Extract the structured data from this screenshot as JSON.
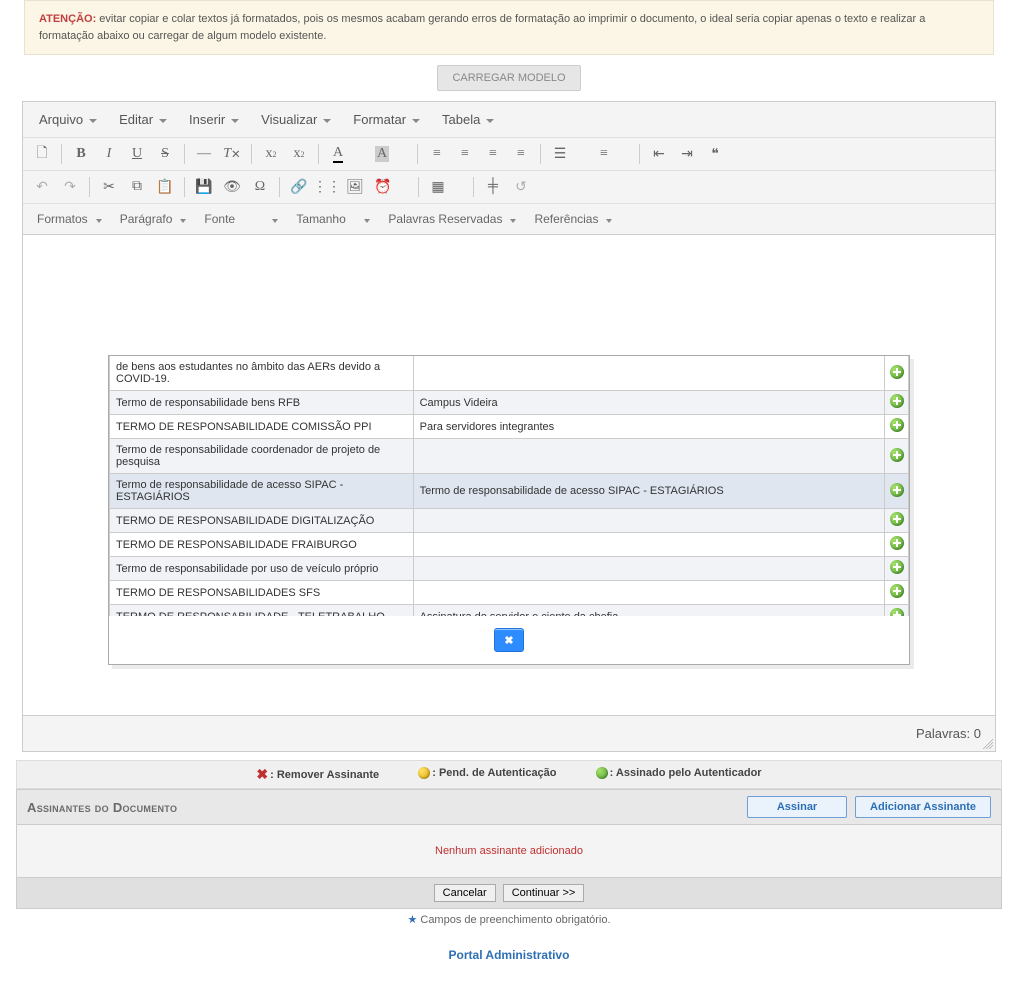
{
  "warning": {
    "prefix": "ATENÇÃO:",
    "text": "evitar copiar e colar textos já formatados, pois os mesmos acabam gerando erros de formatação ao imprimir o documento, o ideal seria copiar apenas o texto e realizar a formatação abaixo ou carregar de algum modelo existente."
  },
  "buttons": {
    "carregar_modelo": "CARREGAR MODELO",
    "assinar": "Assinar",
    "adicionar_assinante": "Adicionar Assinante",
    "cancelar": "Cancelar",
    "continuar": "Continuar >>",
    "close_x": "✖"
  },
  "editor_menu": {
    "arquivo": "Arquivo",
    "editar": "Editar",
    "inserir": "Inserir",
    "visualizar": "Visualizar",
    "formatar": "Formatar",
    "tabela": "Tabela"
  },
  "editor_dropdowns": {
    "formatos": "Formatos",
    "paragrafo": "Parágrafo",
    "fonte": "Fonte",
    "tamanho": "Tamanho",
    "palavras_reservadas": "Palavras Reservadas",
    "referencias": "Referências"
  },
  "editor_footer": {
    "palavras_label": "Palavras:",
    "palavras_count": "0"
  },
  "modal_rows": [
    {
      "col1": "de bens aos estudantes no âmbito das AERs devido a COVID-19.",
      "col2": "",
      "truncated_top": true
    },
    {
      "col1": "Termo de responsabilidade bens RFB",
      "col2": "Campus Videira"
    },
    {
      "col1": "TERMO DE RESPONSABILIDADE COMISSÃO PPI",
      "col2": "Para servidores integrantes"
    },
    {
      "col1": "Termo de responsabilidade coordenador de projeto de pesquisa",
      "col2": ""
    },
    {
      "col1": "Termo de responsabilidade de acesso SIPAC - ESTAGIÁRIOS",
      "col2": "Termo de responsabilidade de acesso SIPAC - ESTAGIÁRIOS",
      "selected": true
    },
    {
      "col1": "TERMO DE RESPONSABILIDADE DIGITALIZAÇÃO",
      "col2": ""
    },
    {
      "col1": "TERMO DE RESPONSABILIDADE FRAIBURGO",
      "col2": ""
    },
    {
      "col1": "Termo de responsabilidade por uso de veículo próprio",
      "col2": ""
    },
    {
      "col1": "TERMO DE RESPONSABILIDADES SFS",
      "col2": ""
    },
    {
      "col1": "TERMO DE RESPONSABILIDADE - TELETRABALHO",
      "col2": "Assinatura do servidor e ciente da chefia"
    }
  ],
  "legend": {
    "remover": ": Remover Assinante",
    "pendente": ": Pend. de Autenticação",
    "assinado": ": Assinado pelo Autenticador"
  },
  "assinantes": {
    "title": "Assinantes do Documento",
    "empty": "Nenhum assinante adicionado"
  },
  "required_note": "Campos de preenchimento obrigatório.",
  "portal_link": "Portal Administrativo"
}
